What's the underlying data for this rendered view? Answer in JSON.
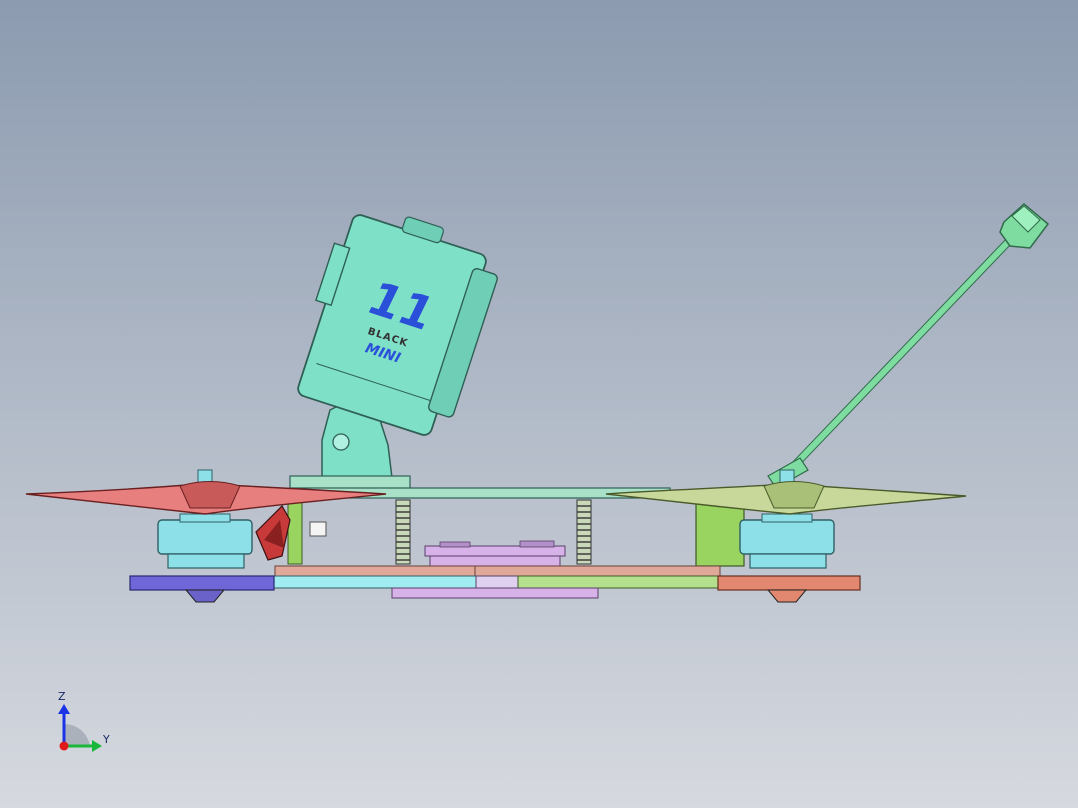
{
  "viewport": {
    "background_top": "#8c9bb0",
    "background_bottom": "#d6d9df"
  },
  "camera": {
    "number": "11",
    "brand": "BLACK",
    "model": "MINI"
  },
  "triad": {
    "z_label": "Z",
    "y_label": "Y"
  },
  "colors": {
    "camera_body": "#7fe0c8",
    "antenna": "#7fdca0",
    "prop_left": "#e77f7f",
    "prop_right": "#c8d89a",
    "motor": "#8ee0e8",
    "arm_left": "#6f67d8",
    "arm_right": "#e28870",
    "top_plate": "#a8e0c8",
    "stack_board": "#d7b2e8",
    "standoff": "#9ad460",
    "spring": "#5a6a4a",
    "axis_z": "#1a33e6",
    "axis_y": "#19b83a",
    "axis_x": "#e01a1a"
  }
}
